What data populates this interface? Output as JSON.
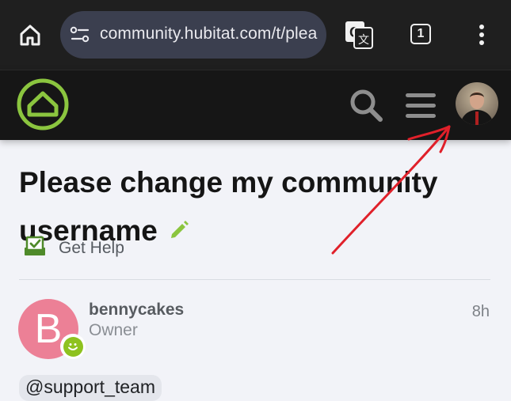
{
  "browser": {
    "url": "community.hubitat.com/t/plea",
    "tab_count": "1",
    "icons": [
      "home-icon",
      "site-settings-icon",
      "translate-icon",
      "tab-switcher-icon",
      "more-vert-icon"
    ]
  },
  "site_header": {
    "icons": [
      "hubitat-logo",
      "search-icon",
      "hamburger-menu-icon",
      "user-avatar"
    ],
    "brand_color": "#8bc53f"
  },
  "topic": {
    "title_line1": "Please change my community",
    "title_line2": "username",
    "category": "Get Help"
  },
  "post": {
    "avatar_letter": "B",
    "avatar_color": "#ec8096",
    "username": "bennycakes",
    "user_title": "Owner",
    "time": "8h",
    "mention": "@support_team"
  },
  "annotation_color": "#e0202a"
}
